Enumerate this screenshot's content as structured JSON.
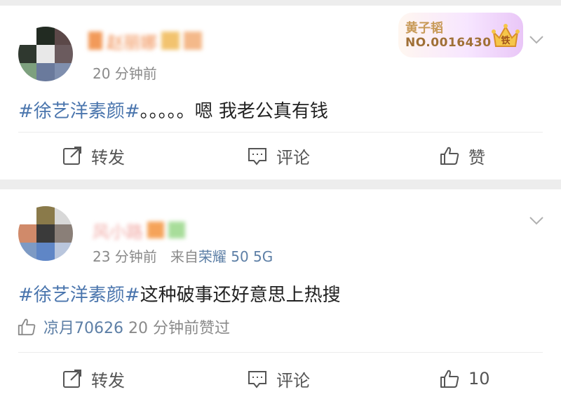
{
  "posts": [
    {
      "username": "赵丽娜",
      "time": "20 分钟前",
      "hashtag": "#徐艺洋素颜#",
      "text": "。。。。。嗯 我老公真有钱",
      "badge": {
        "title": "黄子韬",
        "number": "NO.0016430",
        "crown_text": "铁"
      },
      "actions": {
        "repost": "转发",
        "comment": "评论",
        "like": "赞"
      }
    },
    {
      "username": "风小路",
      "time": "23 分钟前",
      "source_prefix": "来自",
      "device": "荣耀 50 5G",
      "hashtag": "#徐艺洋素颜#",
      "text": "这种破事还好意思上热搜",
      "liked_by": {
        "user": "凉月70626",
        "suffix": "20 分钟前赞过"
      },
      "actions": {
        "repost": "转发",
        "comment": "评论",
        "like_count": "10"
      }
    }
  ],
  "colors": {
    "hashtag": "#4a75ad",
    "device": "#5d7fa6",
    "meta": "#8a8a8a",
    "divider": "#ececec"
  }
}
